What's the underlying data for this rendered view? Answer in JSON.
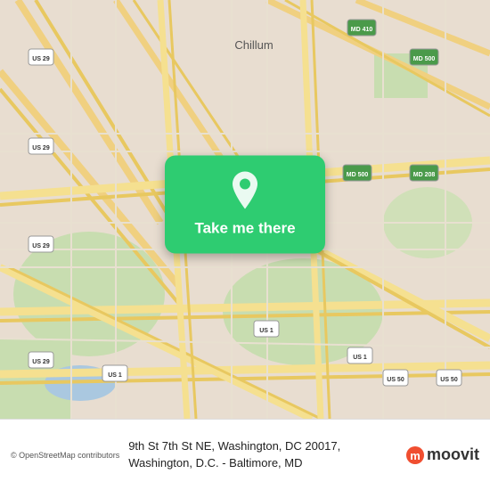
{
  "map": {
    "alt": "Map of Washington DC area showing 9th St 7th St NE",
    "background_color": "#e8e0d8"
  },
  "overlay": {
    "button_label": "Take me there",
    "pin_icon": "map-pin-icon"
  },
  "bottom_bar": {
    "osm_credit": "© OpenStreetMap contributors",
    "address": "9th St 7th St NE, Washington, DC 20017, Washington, D.C. - Baltimore, MD",
    "moovit_label": "moovit"
  }
}
